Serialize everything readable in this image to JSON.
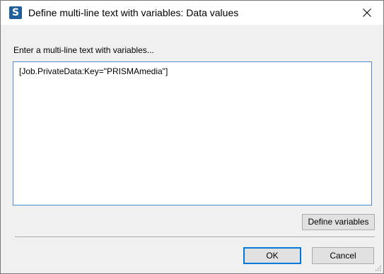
{
  "window": {
    "title": "Define multi-line text with variables: Data values",
    "app_icon_letter": "S"
  },
  "prompt": {
    "label": "Enter a multi-line text with variables..."
  },
  "editor": {
    "value": "[Job.PrivateData:Key=\"PRISMAmedia\"]"
  },
  "buttons": {
    "define_variables": "Define variables",
    "ok": "OK",
    "cancel": "Cancel"
  },
  "colors": {
    "accent": "#0078d7",
    "app_icon_bg": "#1f5f9e",
    "dialog_bg": "#f0f0f0"
  }
}
